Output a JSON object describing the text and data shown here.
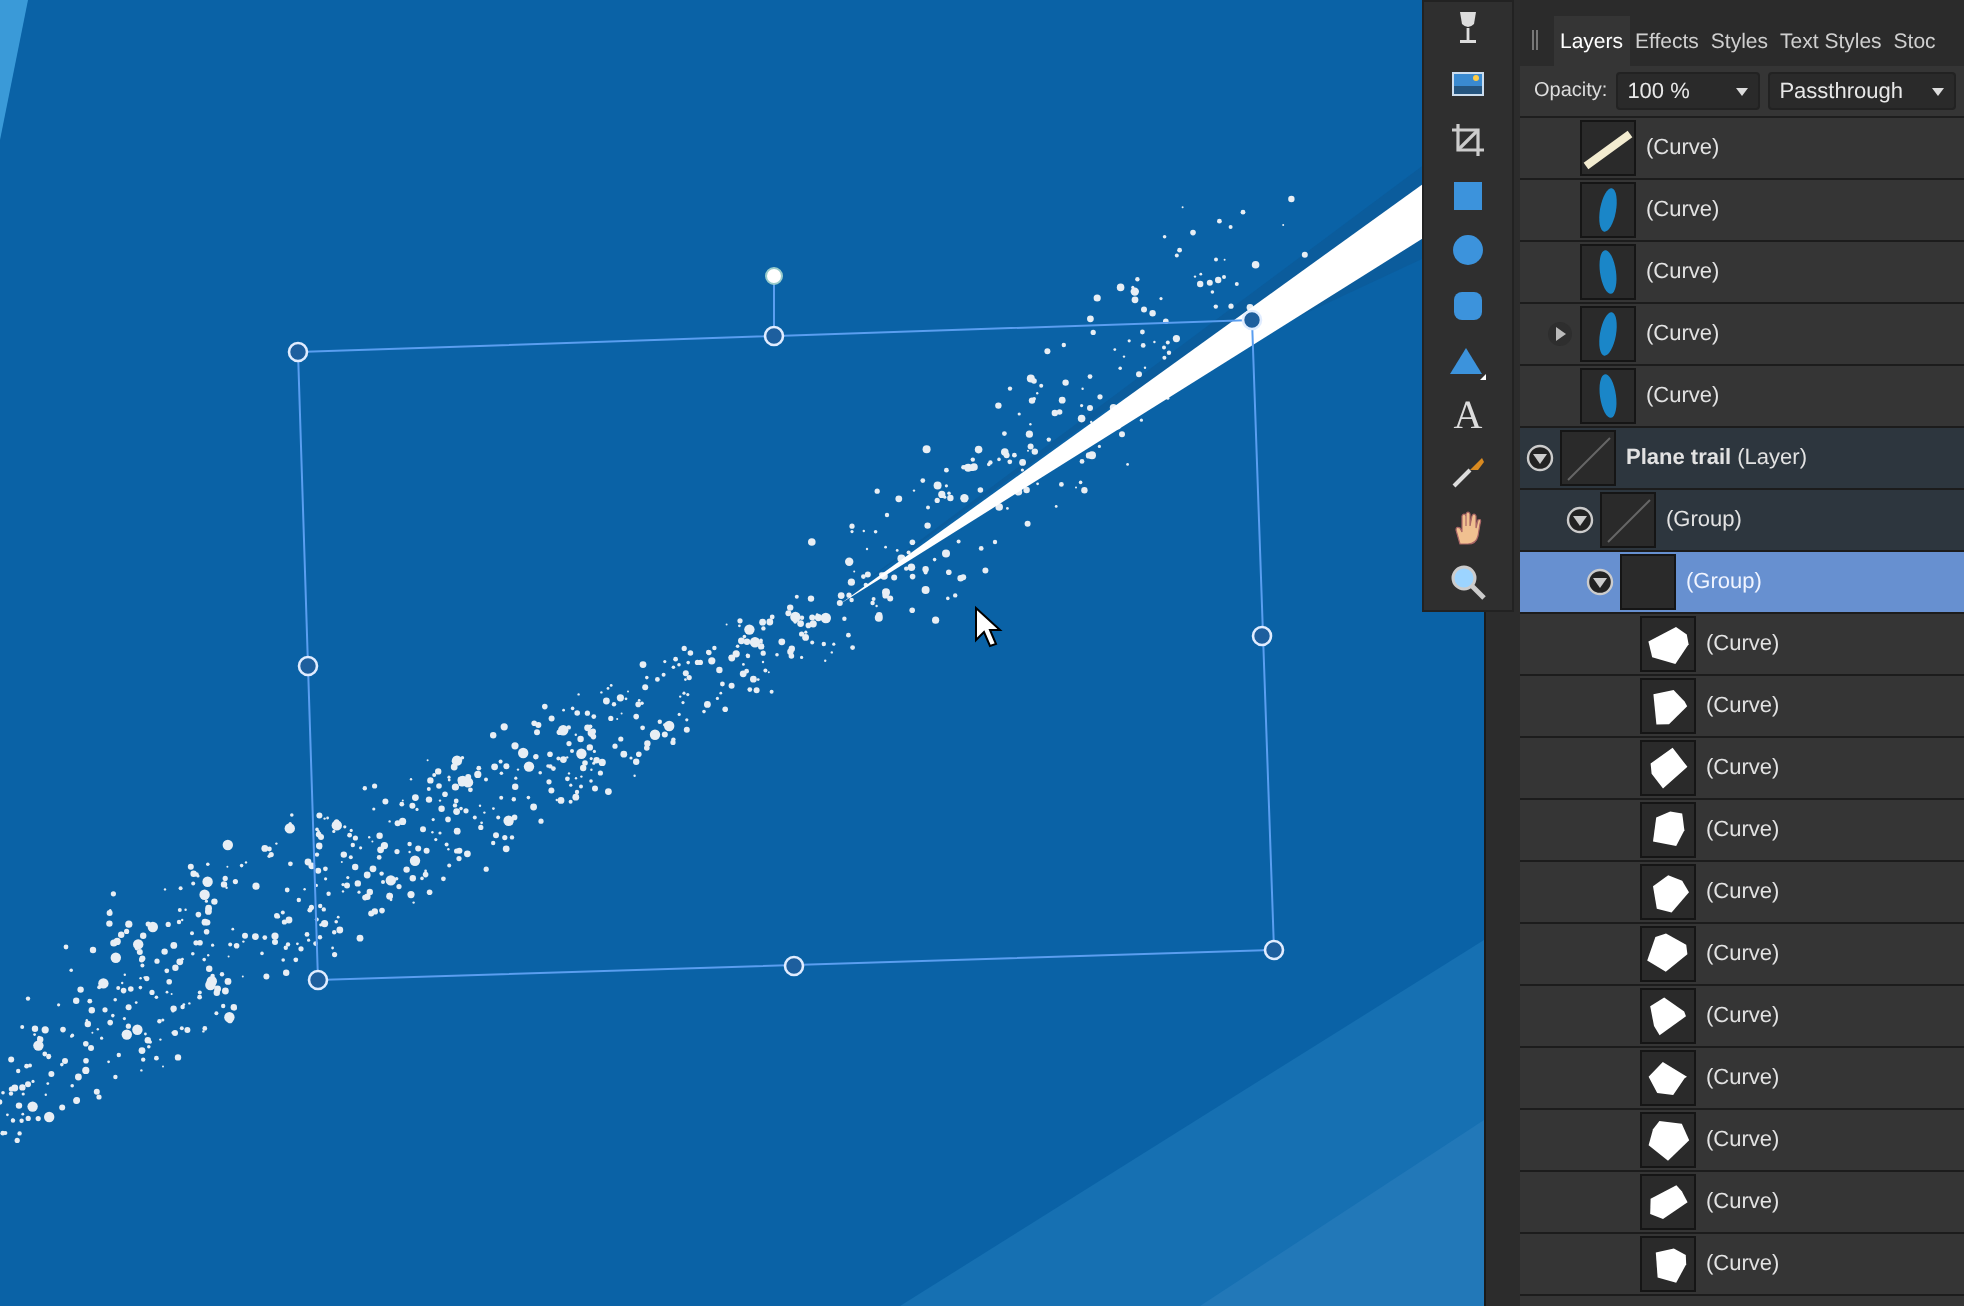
{
  "tools": [
    {
      "kind": "glass"
    },
    {
      "kind": "image"
    },
    {
      "kind": "crop"
    },
    {
      "kind": "rect"
    },
    {
      "kind": "ellipse"
    },
    {
      "kind": "rounded"
    },
    {
      "kind": "triangle"
    },
    {
      "kind": "text",
      "glyph": "A"
    },
    {
      "kind": "picker"
    },
    {
      "kind": "hand"
    },
    {
      "kind": "zoom"
    }
  ],
  "panel": {
    "tabs": [
      {
        "label": "Layers",
        "selected": true
      },
      {
        "label": "Effects",
        "selected": false
      },
      {
        "label": "Styles",
        "selected": false
      },
      {
        "label": "Text Styles",
        "selected": false
      },
      {
        "label": "Stoc",
        "selected": false
      }
    ],
    "opacity_label": "Opacity:",
    "opacity": "100 %",
    "blend_mode": "Passthrough",
    "layers": [
      {
        "kind": "object",
        "name": "(Curve)",
        "thumbnail": {
          "kind": "line"
        },
        "selected": false
      },
      {
        "kind": "object",
        "name": "(Curve)",
        "thumbnail": {
          "kind": "blob"
        },
        "selected": false
      },
      {
        "kind": "object",
        "name": "(Curve)",
        "thumbnail": {
          "kind": "blob"
        },
        "selected": false
      },
      {
        "kind": "object",
        "name": "(Curve)",
        "thumbnail": {
          "kind": "blob"
        },
        "expanded": false,
        "selected": false
      },
      {
        "kind": "object",
        "name": "(Curve)",
        "thumbnail": {
          "kind": "blob"
        },
        "selected": false
      },
      {
        "kind": "layer",
        "name": "Plane trail",
        "type": "(Layer)",
        "thumbnail": {
          "kind": "trail"
        },
        "expanded": true,
        "selected": false,
        "children": [
          {
            "kind": "group",
            "name": "(Group)",
            "thumbnail": {
              "kind": "trail"
            },
            "expanded": true,
            "selected": false,
            "children": [
              {
                "kind": "group",
                "name": "(Group)",
                "expanded": true,
                "selected": true,
                "children": [
                  {
                    "kind": "object",
                    "name": "(Curve)",
                    "thumbnail": {
                      "kind": "shape"
                    },
                    "selected": false
                  },
                  {
                    "kind": "object",
                    "name": "(Curve)",
                    "thumbnail": {
                      "kind": "shape"
                    },
                    "selected": false
                  },
                  {
                    "kind": "object",
                    "name": "(Curve)",
                    "thumbnail": {
                      "kind": "shape"
                    },
                    "selected": false
                  },
                  {
                    "kind": "object",
                    "name": "(Curve)",
                    "thumbnail": {
                      "kind": "shape"
                    },
                    "selected": false
                  },
                  {
                    "kind": "object",
                    "name": "(Curve)",
                    "thumbnail": {
                      "kind": "shape"
                    },
                    "selected": false
                  },
                  {
                    "kind": "object",
                    "name": "(Curve)",
                    "thumbnail": {
                      "kind": "shape"
                    },
                    "selected": false
                  },
                  {
                    "kind": "object",
                    "name": "(Curve)",
                    "thumbnail": {
                      "kind": "shape"
                    },
                    "selected": false
                  },
                  {
                    "kind": "object",
                    "name": "(Curve)",
                    "thumbnail": {
                      "kind": "shape"
                    },
                    "selected": false
                  },
                  {
                    "kind": "object",
                    "name": "(Curve)",
                    "thumbnail": {
                      "kind": "shape"
                    },
                    "selected": false
                  },
                  {
                    "kind": "object",
                    "name": "(Curve)",
                    "thumbnail": {
                      "kind": "shape"
                    },
                    "selected": false
                  },
                  {
                    "kind": "object",
                    "name": "(Curve)",
                    "thumbnail": {
                      "kind": "shape"
                    },
                    "selected": false
                  }
                ]
              }
            ]
          }
        ]
      }
    ]
  }
}
